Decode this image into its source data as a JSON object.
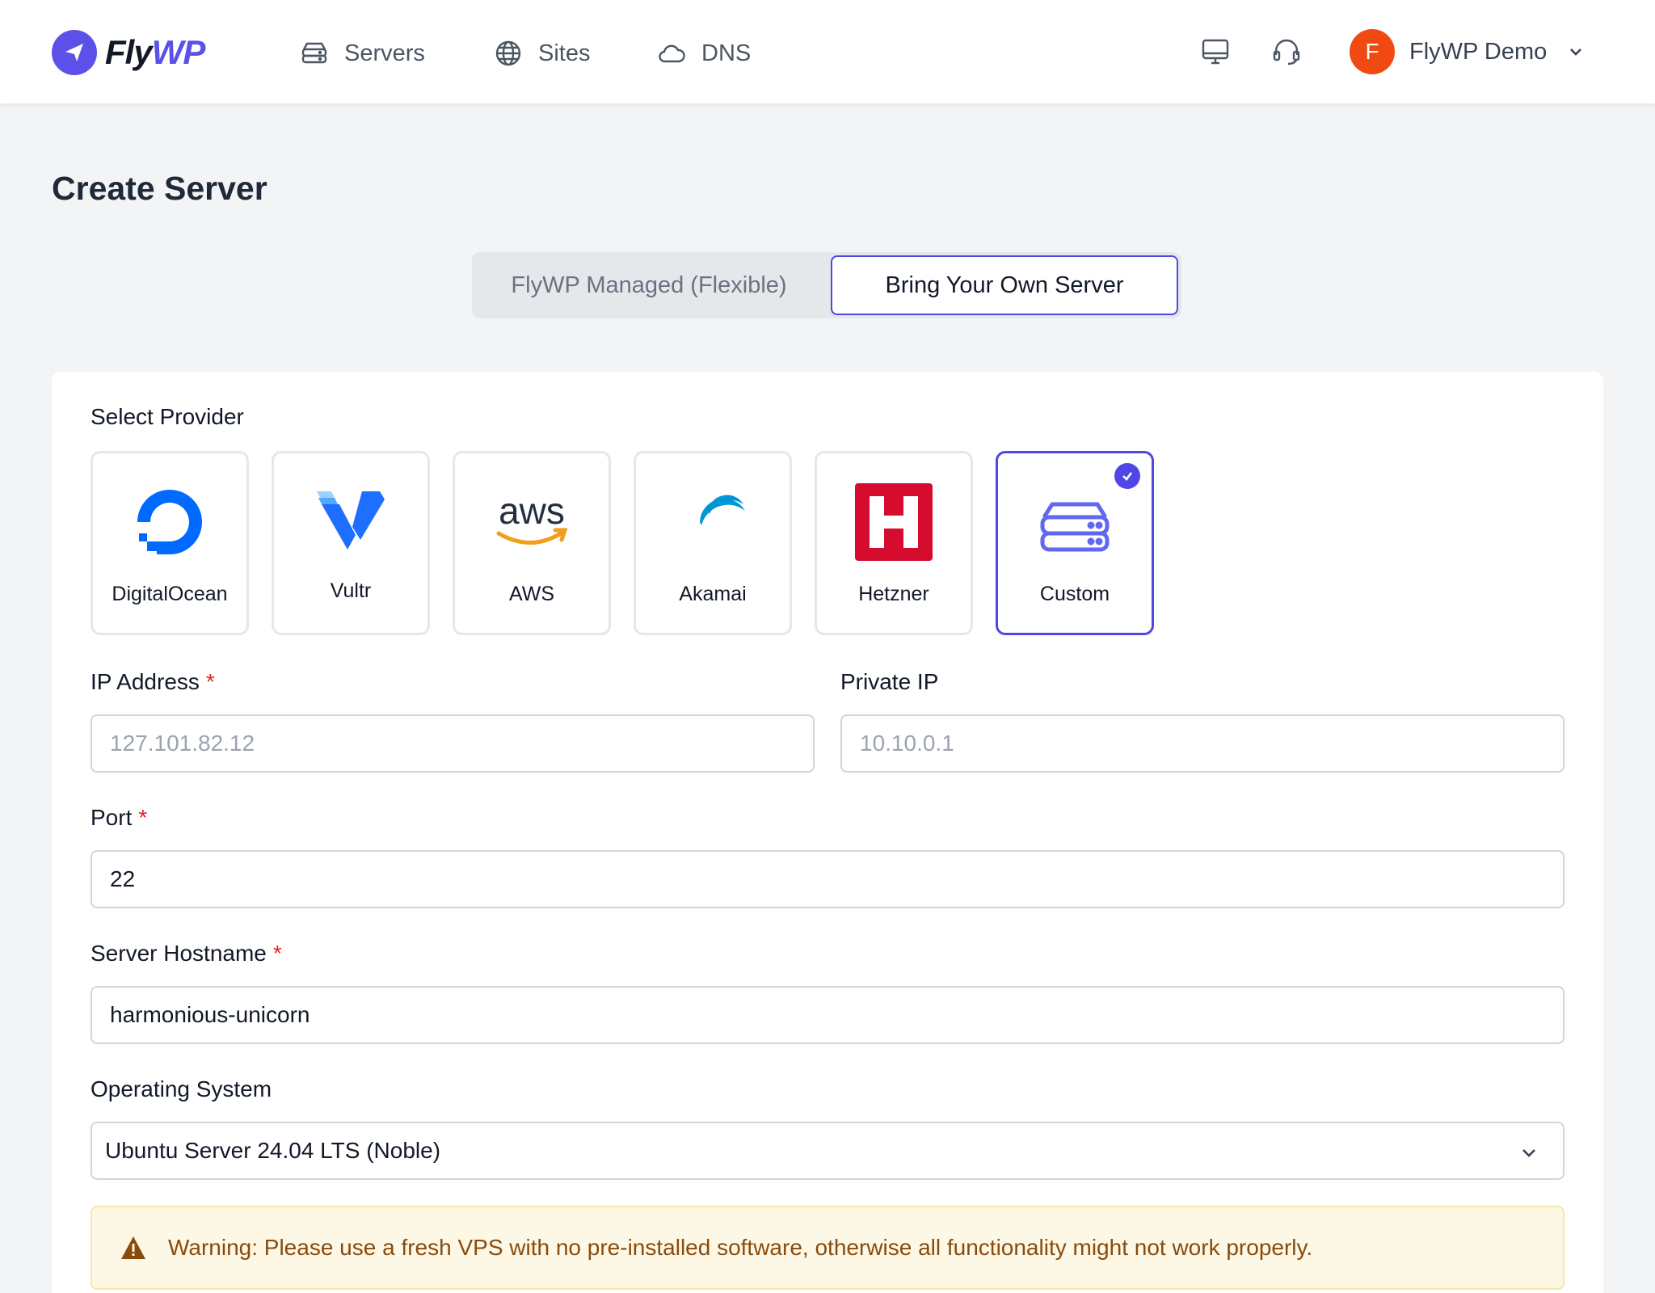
{
  "brand": {
    "part1": "Fly",
    "part2": "WP"
  },
  "nav": [
    {
      "label": "Servers",
      "icon": "server-icon"
    },
    {
      "label": "Sites",
      "icon": "globe-icon"
    },
    {
      "label": "DNS",
      "icon": "cloud-icon"
    }
  ],
  "header_icons": [
    "monitor-icon",
    "headset-icon"
  ],
  "user": {
    "initial": "F",
    "name": "FlyWP Demo",
    "avatar_color": "#f04a12"
  },
  "page_title": "Create Server",
  "toggle": {
    "options": [
      "FlyWP Managed (Flexible)",
      "Bring Your Own Server"
    ],
    "selected": "Bring Your Own Server"
  },
  "provider_section": {
    "label": "Select Provider",
    "providers": [
      {
        "name": "DigitalOcean",
        "icon": "digitalocean-logo",
        "selected": false
      },
      {
        "name": "Vultr",
        "icon": "vultr-logo",
        "selected": false
      },
      {
        "name": "AWS",
        "icon": "aws-logo",
        "selected": false
      },
      {
        "name": "Akamai",
        "icon": "akamai-logo",
        "selected": false
      },
      {
        "name": "Hetzner",
        "icon": "hetzner-logo",
        "selected": false
      },
      {
        "name": "Custom",
        "icon": "server-stack-icon",
        "selected": true
      }
    ]
  },
  "form": {
    "ip": {
      "label": "IP Address",
      "required_mark": "*",
      "value": "",
      "placeholder": "127.101.82.12"
    },
    "private_ip": {
      "label": "Private IP",
      "value": "",
      "placeholder": "10.10.0.1"
    },
    "port": {
      "label": "Port",
      "required_mark": "*",
      "value": "22"
    },
    "hostname": {
      "label": "Server Hostname",
      "required_mark": "*",
      "value": "harmonious-unicorn"
    },
    "os": {
      "label": "Operating System",
      "selected": "Ubuntu Server 24.04 LTS (Noble)"
    }
  },
  "warning": {
    "text": "Warning: Please use a fresh VPS with no pre-installed software, otherwise all functionality might not work properly."
  },
  "colors": {
    "accent": "#4f46e5",
    "brand": "#5b50e8",
    "required": "#e02424",
    "warning_bg": "#fdf8e6",
    "warning_text": "#8a4a0b"
  }
}
